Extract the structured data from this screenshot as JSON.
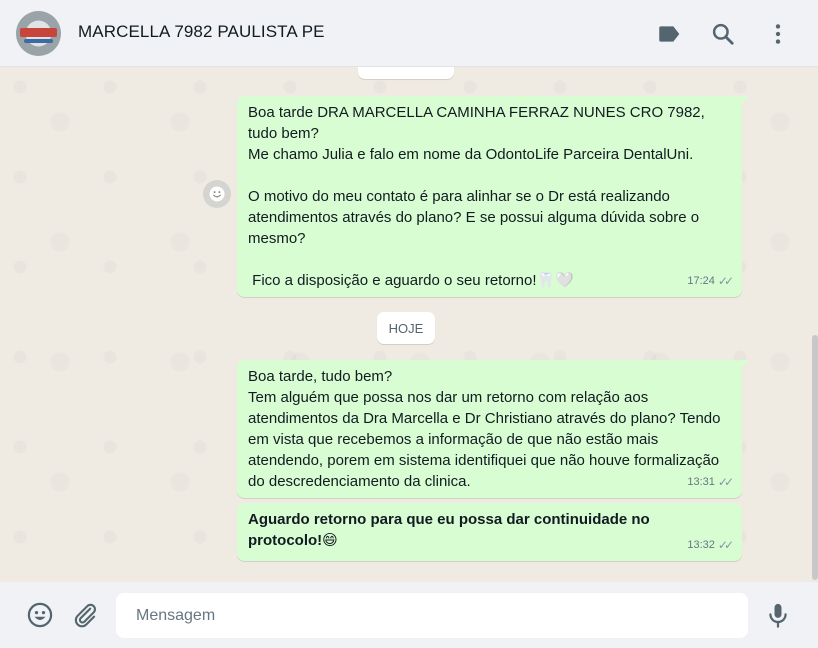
{
  "header": {
    "contact_name": "MARCELLA 7982 PAULISTA PE",
    "icons": [
      "label-icon",
      "search-icon",
      "menu-icon"
    ]
  },
  "messages": [
    {
      "text": "Boa tarde DRA MARCELLA CAMINHA FERRAZ NUNES CRO 7982, tudo bem?\nMe chamo Julia e falo em nome da OdontoLife Parceira DentalUni.\n\nO motivo do meu contato é para alinhar se o Dr está realizando atendimentos através do plano? E se possui alguma dúvida sobre o mesmo?\n\n Fico a disposição e aguardo o seu retorno!🦷🤍",
      "time": "17:24"
    },
    {
      "text": "Boa tarde, tudo bem?\nTem alguém que possa nos dar um retorno com relação aos atendimentos da Dra Marcella e Dr Christiano através do plano? Tendo em vista que recebemos a informação de que não estão mais atendendo, porem em sistema identifiquei que não houve formalização do descredenciamento da clinica.",
      "time": "13:31"
    },
    {
      "text": "Aguardo retorno para que eu possa dar continuidade no protocolo!😄",
      "time": "13:32"
    }
  ],
  "date_divider": "HOJE",
  "composer": {
    "placeholder": "Mensagem",
    "icons": [
      "emoji-icon",
      "attach-icon",
      "mic-icon"
    ]
  },
  "colors": {
    "outgoing_bubble": "#d9fdd3",
    "chat_background": "#efeae2",
    "header_background": "#f0f2f5"
  }
}
